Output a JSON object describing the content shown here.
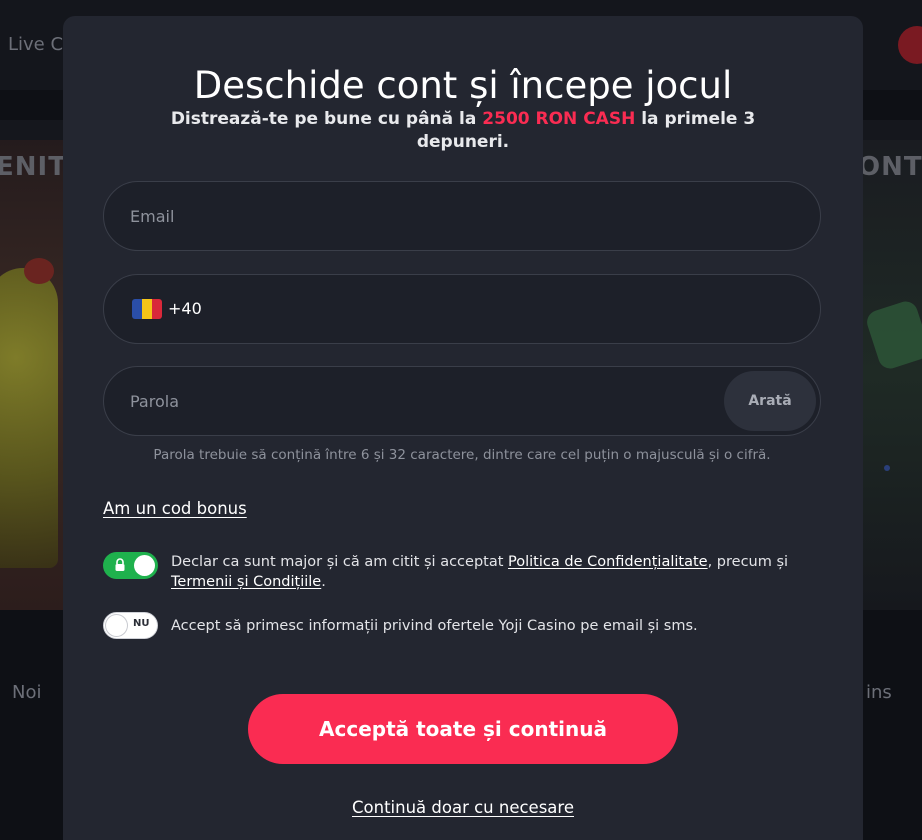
{
  "background": {
    "nav_link": "Live C",
    "heading_left": "ENIT",
    "heading_right": "ONT",
    "category_left": "Noi",
    "category_right": "ins"
  },
  "modal": {
    "title": "Deschide cont și începe jocul",
    "subtitle_before": "Distrează-te pe bune cu până la ",
    "subtitle_highlight": "2500 RON CASH",
    "subtitle_after": " la primele 3 depuneri.",
    "email_placeholder": "Email",
    "email_value": "",
    "phone_prefix": "+40",
    "phone_value": "",
    "country_flag": "romania-flag",
    "password_placeholder": "Parola",
    "password_value": "",
    "show_password_label": "Arată",
    "password_hint": "Parola trebuie să conțină între 6 și 32 caractere, dintre care cel puțin o majusculă și o cifră.",
    "bonus_code_link": "Am un cod bonus",
    "consent_age": {
      "enabled": true,
      "locked": true,
      "text_before": "Declar ca sunt major și că am citit și acceptat ",
      "privacy_link": "Politica de Confidențialitate",
      "text_middle": ", precum și ",
      "terms_link": "Termenii și Condițiile",
      "text_after": "."
    },
    "consent_marketing": {
      "enabled": false,
      "toggle_label": "NU",
      "text": "Accept să primesc informații privind ofertele Yoji Casino pe email și sms."
    },
    "accept_all_button": "Acceptă toate și continuă",
    "necessary_only_link": "Continuă doar cu necesare"
  },
  "colors": {
    "accent": "#fa2c52",
    "toggle_on": "#1fb14d",
    "modal_bg": "#232630",
    "field_bg": "#1d2029",
    "page_bg": "#0e1015"
  }
}
